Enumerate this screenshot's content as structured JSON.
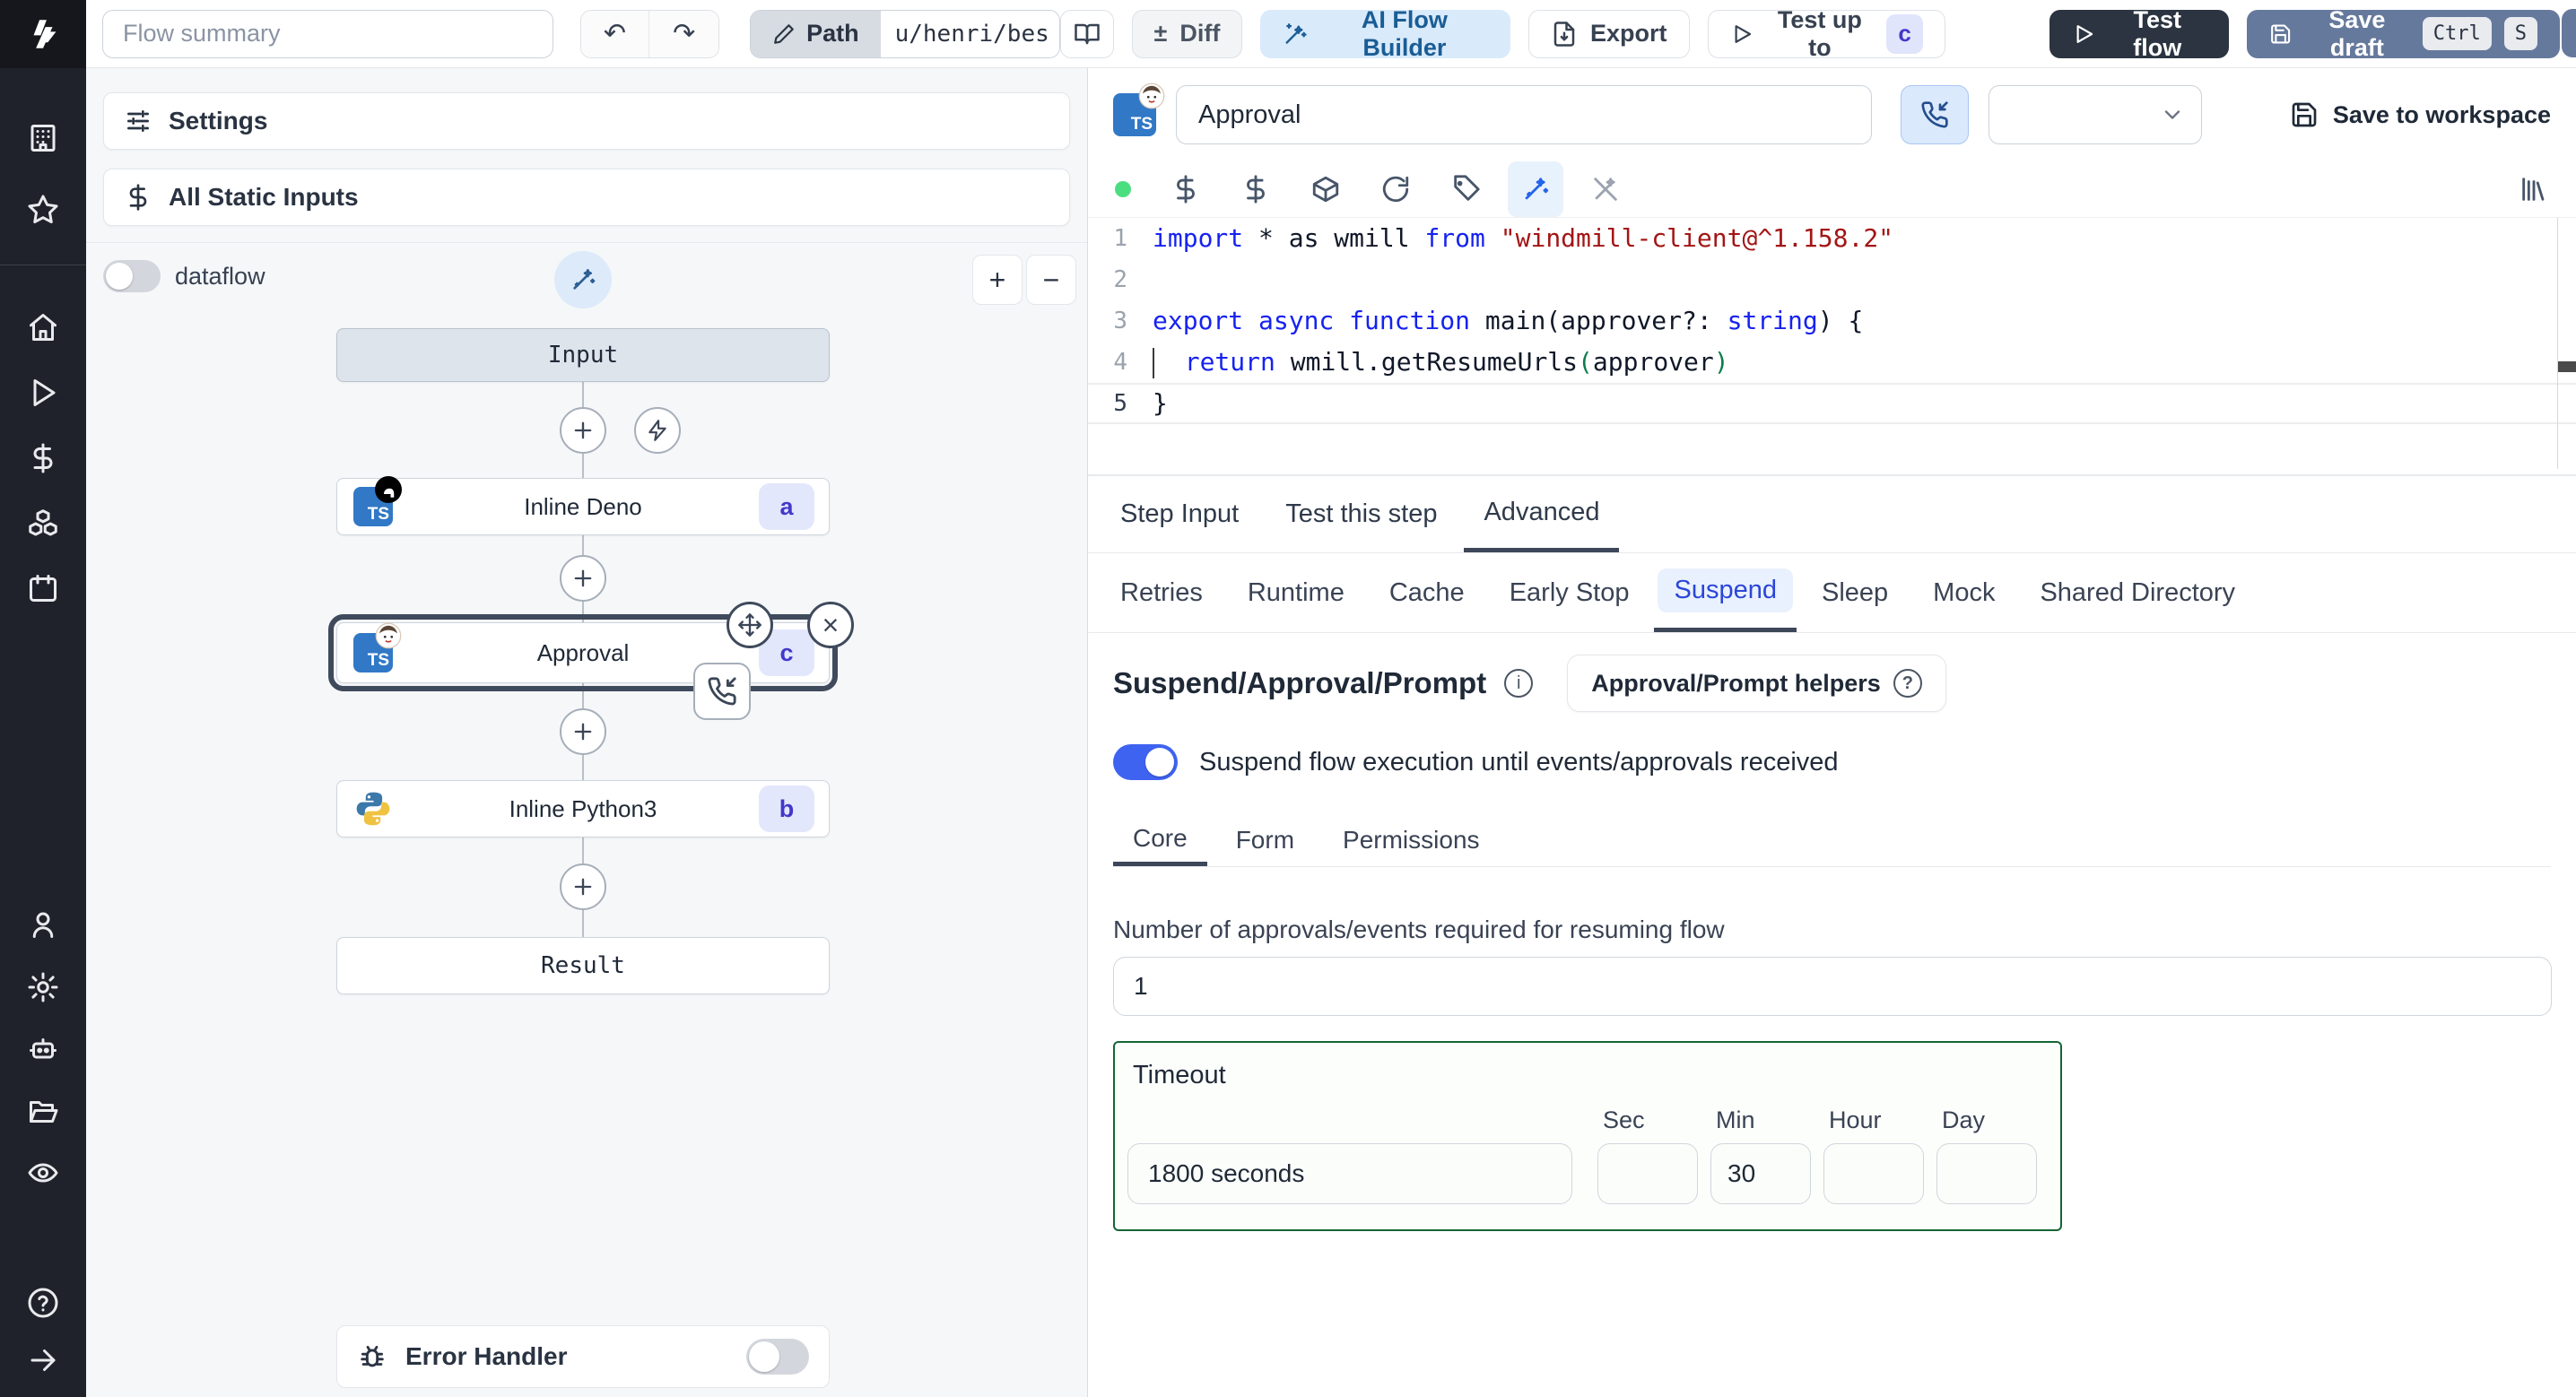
{
  "topbar": {
    "flow_summary_placeholder": "Flow summary",
    "path_label": "Path",
    "path_value": "u/henri/bes",
    "diff_label": "Diff",
    "diff_icon": "±",
    "ai_flow_builder_label": "AI Flow Builder",
    "export_label": "Export",
    "test_up_to_label": "Test up to",
    "test_up_to_badge": "c",
    "test_flow_label": "Test flow",
    "save_draft_label": "Save draft",
    "save_draft_key1": "Ctrl",
    "save_draft_key2": "S"
  },
  "flow_panel": {
    "settings_label": "Settings",
    "static_inputs_label": "All Static Inputs",
    "dataflow_label": "dataflow",
    "zoom_in": "+",
    "zoom_out": "−",
    "ts_label": "TS",
    "nodes": {
      "input_label": "Input",
      "deno_label": "Inline Deno",
      "deno_badge": "a",
      "approval_label": "Approval",
      "approval_badge": "c",
      "python_label": "Inline Python3",
      "python_badge": "b",
      "result_label": "Result"
    },
    "close_glyph": "×",
    "error_handler_label": "Error Handler"
  },
  "step_panel": {
    "ts_label": "TS",
    "name_value": "Approval",
    "save_to_workspace_label": "Save to workspace",
    "code": {
      "lines": [
        {
          "n": "1",
          "s": [
            "import",
            " * as wmill ",
            "from",
            " ",
            "\"windmill-client@^1.158.2\""
          ]
        },
        {
          "n": "2"
        },
        {
          "n": "3",
          "s": [
            "export async function",
            " main(approver?: ",
            "string",
            ") {"
          ]
        },
        {
          "n": "4",
          "s": [
            "  ",
            "return",
            " wmill.getResumeUrls",
            "(",
            "approver",
            ")"
          ]
        },
        {
          "n": "5",
          "s": [
            "}"
          ]
        }
      ]
    },
    "tabs": [
      "Step Input",
      "Test this step",
      "Advanced"
    ],
    "subtabs": [
      "Retries",
      "Runtime",
      "Cache",
      "Early Stop",
      "Suspend",
      "Sleep",
      "Mock",
      "Shared Directory"
    ],
    "suspend": {
      "heading": "Suspend/Approval/Prompt",
      "info_glyph": "i",
      "helpers_label": "Approval/Prompt helpers",
      "help_glyph": "?",
      "toggle_label": "Suspend flow execution until events/approvals received",
      "core_tab": "Core",
      "form_tab": "Form",
      "permissions_tab": "Permissions",
      "approvals_label": "Number of approvals/events required for resuming flow",
      "approvals_value": "1",
      "timeout_label": "Timeout",
      "timeout_value": "1800 seconds",
      "sec_label": "Sec",
      "min_label": "Min",
      "hour_label": "Hour",
      "day_label": "Day",
      "sec_value": "",
      "min_value": "30",
      "hour_value": "",
      "day_value": ""
    }
  },
  "icons": {
    "sidebar": [
      "windmill-logo",
      "building",
      "star",
      "home",
      "play",
      "dollar",
      "boxes",
      "calendar",
      "user",
      "gear",
      "bot",
      "folder-open",
      "eye",
      "help-circle",
      "arrow-right"
    ],
    "topbar": [
      "undo",
      "redo",
      "pencil",
      "book-open",
      "plus-minus",
      "wand-sparkles",
      "file-export",
      "play",
      "save"
    ],
    "editor_toolbar": [
      "status-dot",
      "dollar",
      "dollar",
      "package",
      "refresh",
      "tag",
      "ai-wand",
      "ai-wand-off",
      "library"
    ],
    "other": [
      "sliders",
      "magic-wand",
      "plus",
      "zap",
      "move",
      "close",
      "phone-incoming",
      "chevron-down",
      "bug",
      "info",
      "help"
    ]
  },
  "colors": {
    "accent_blue": "#2563eb",
    "toggle_on": "#3f63f1",
    "badge_bg": "#e1e5fb",
    "badge_text": "#4338ca",
    "timeout_border": "#166534",
    "dark_button": "#2b3440",
    "save_draft": "#65799c",
    "ai_builder_bg": "#d9eafb",
    "sidebar_bg": "#1f222a",
    "flow_bg": "#f5f7f9",
    "status_green": "#4ade80"
  }
}
